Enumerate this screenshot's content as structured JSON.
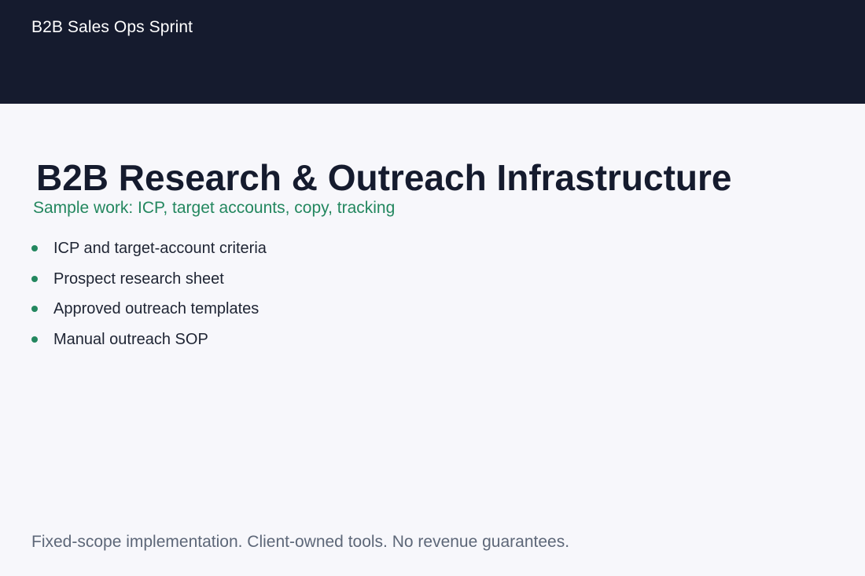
{
  "header": {
    "brand": "B2B Sales Ops Sprint"
  },
  "main": {
    "title": "B2B Research & Outreach Infrastructure",
    "subtitle": "Sample work: ICP, target accounts, copy, tracking",
    "items": [
      "ICP and target-account criteria",
      "Prospect research sheet",
      "Approved outreach templates",
      "Manual outreach SOP"
    ]
  },
  "footer": {
    "note": "Fixed-scope implementation. Client-owned tools. No revenue guarantees."
  },
  "colors": {
    "header_background": "#151b2e",
    "accent": "#23875f",
    "page_background": "#f7f7fb",
    "body_text": "#1e2433",
    "muted_text": "#5d6778"
  }
}
